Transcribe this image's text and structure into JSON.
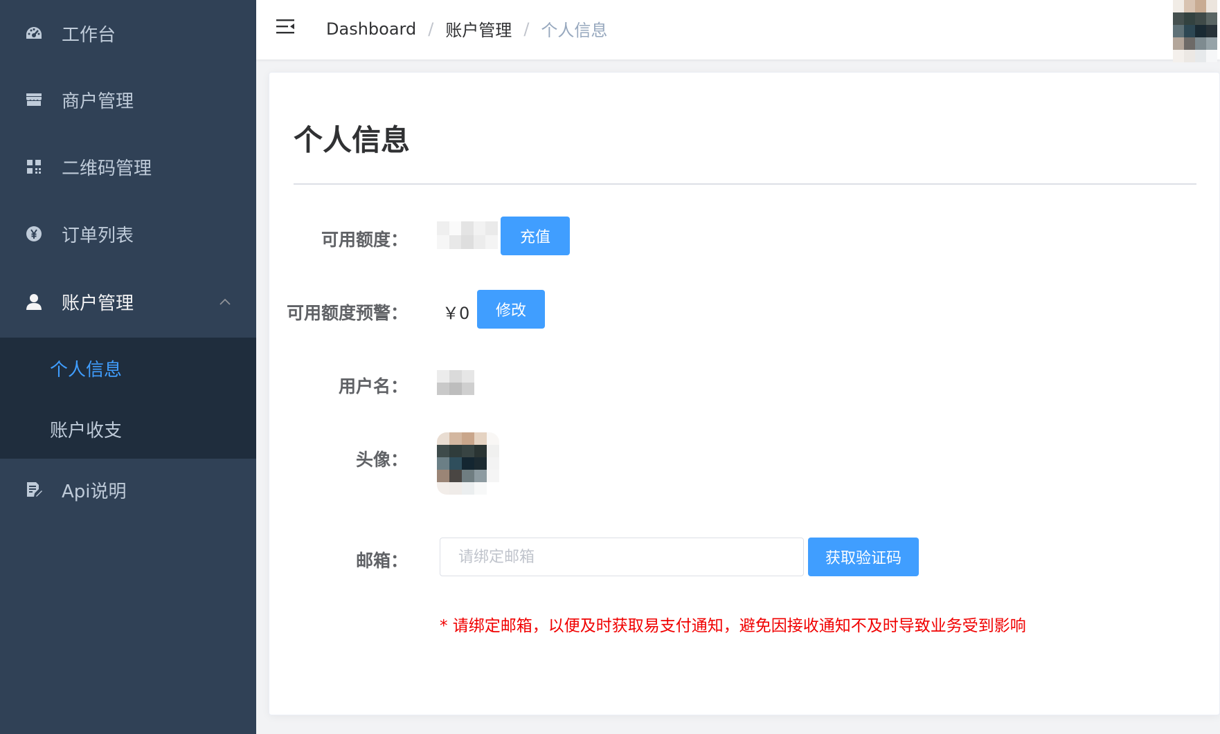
{
  "sidebar": {
    "items": [
      {
        "label": "工作台",
        "icon": "dashboard-icon"
      },
      {
        "label": "商户管理",
        "icon": "store-icon"
      },
      {
        "label": "二维码管理",
        "icon": "qrcode-icon"
      },
      {
        "label": "订单列表",
        "icon": "yen-icon"
      },
      {
        "label": "账户管理",
        "icon": "user-icon",
        "expanded": true
      },
      {
        "label": "Api说明",
        "icon": "document-edit-icon"
      }
    ],
    "submenu": [
      {
        "label": "个人信息",
        "active": true
      },
      {
        "label": "账户收支",
        "active": false
      }
    ]
  },
  "header": {
    "breadcrumb": [
      "Dashboard",
      "账户管理",
      "个人信息"
    ],
    "separator": "/"
  },
  "page": {
    "title": "个人信息",
    "fields": {
      "balance": {
        "label": "可用额度：",
        "button": "充值"
      },
      "warning": {
        "label": "可用额度预警：",
        "value": "￥0",
        "button": "修改"
      },
      "username": {
        "label": "用户名："
      },
      "avatar": {
        "label": "头像："
      },
      "email": {
        "label": "邮箱：",
        "placeholder": "请绑定邮箱",
        "value": "",
        "button": "获取验证码"
      }
    },
    "notice": "* 请绑定邮箱，以便及时获取易支付通知，避免因接收通知不及时导致业务受到影响"
  },
  "colors": {
    "sidebar_bg": "#304156",
    "submenu_bg": "#1f2d3d",
    "primary": "#409eff",
    "notice": "#f00000"
  }
}
